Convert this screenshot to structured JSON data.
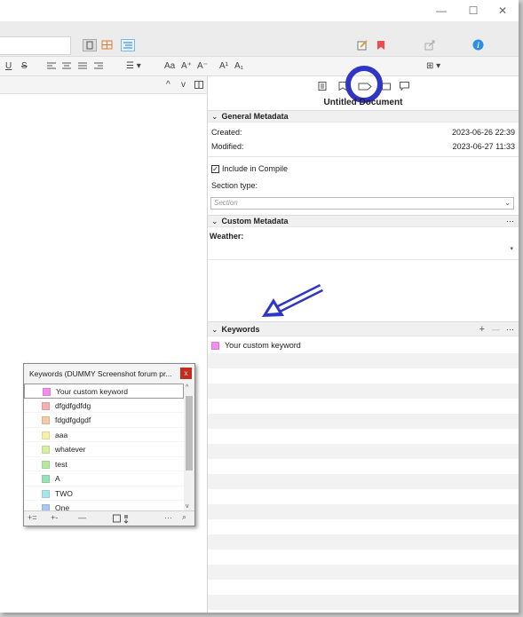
{
  "window": {
    "controls": {
      "minimize": "—",
      "maximize": "☐",
      "close": "✕"
    }
  },
  "format_bar": {
    "underline": "U",
    "strike": "S",
    "list": "☰ ▾",
    "font_case": "Aa",
    "font_bigger": "A⁺",
    "font_smaller": "A⁻",
    "superscript": "A¹",
    "subscript": "A₁",
    "table": "⊞ ▾"
  },
  "editor": {
    "nav_up": "^",
    "nav_down": "v"
  },
  "inspector": {
    "doc_title": "Untitled Document",
    "general": {
      "header": "General Metadata",
      "created_label": "Created:",
      "created_value": "2023-06-26 22:39",
      "modified_label": "Modified:",
      "modified_value": "2023-06-27 11:33",
      "include_label": "Include in Compile",
      "section_type_label": "Section type:",
      "section_placeholder": "Section"
    },
    "custom": {
      "header": "Custom Metadata",
      "weather_label": "Weather:"
    },
    "keywords": {
      "header": "Keywords",
      "add": "+",
      "remove": "—",
      "more": "···",
      "items": [
        {
          "label": "Your custom keyword",
          "color": "#f28ef0"
        }
      ]
    }
  },
  "keywords_window": {
    "title": "Keywords (DUMMY Screenshot forum pr...",
    "close": "x",
    "items": [
      {
        "label": "Your custom keyword",
        "color": "#f28ef0"
      },
      {
        "label": "dfgdfgdfdg",
        "color": "#f7b0ad"
      },
      {
        "label": "fdgdfgdgdf",
        "color": "#f8c9a6"
      },
      {
        "label": "aaa",
        "color": "#f8f0a6"
      },
      {
        "label": "whatever",
        "color": "#d6f0a0"
      },
      {
        "label": "test",
        "color": "#b4eaa0"
      },
      {
        "label": "A",
        "color": "#98e2b8"
      },
      {
        "label": "TWO",
        "color": "#a6e6ea"
      },
      {
        "label": "One",
        "color": "#a6c8f2"
      }
    ],
    "footer": {
      "add_sibling": "+=",
      "add_child": "+-",
      "remove": "—",
      "more": "···",
      "search": "⌕"
    }
  },
  "annotations": {
    "highlight_color": "#2f35c4"
  }
}
